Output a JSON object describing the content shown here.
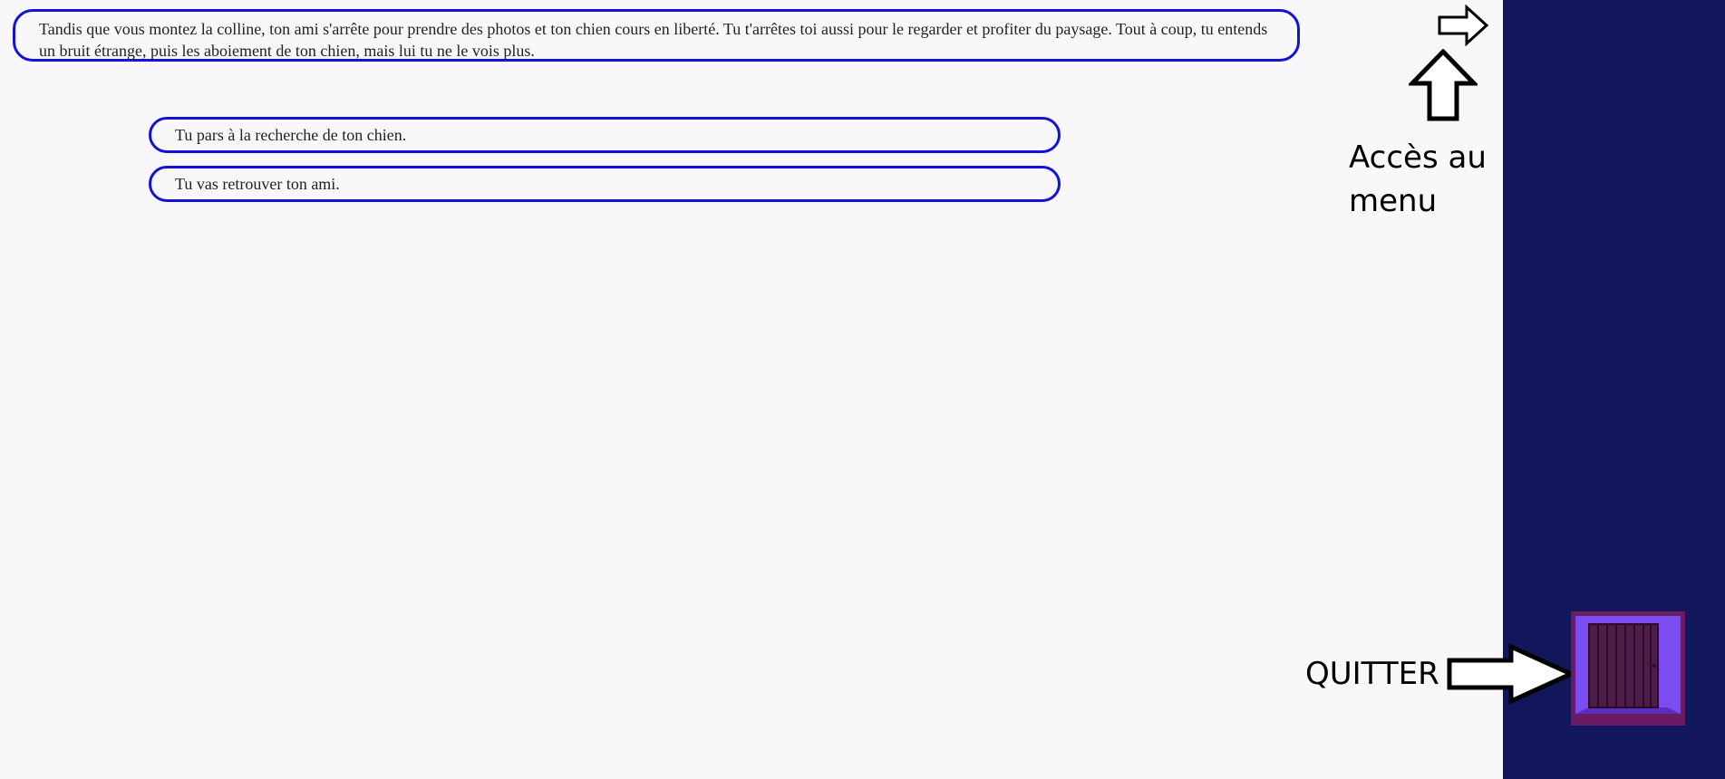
{
  "story": {
    "text": "Tandis que vous montez la colline, ton ami s'arrête pour prendre des photos et ton chien cours en liberté. Tu t'arrêtes toi aussi pour le regarder et profiter du paysage. Tout à coup, tu entends un bruit étrange, puis les aboiement de ton chien, mais lui tu ne le vois plus."
  },
  "choices": [
    {
      "label": "Tu pars à la recherche de ton chien."
    },
    {
      "label": "Tu vas retrouver ton ami."
    }
  ],
  "menu": {
    "label_line1": "Accès au",
    "label_line2": "menu",
    "icon": "arrow-right-icon"
  },
  "quit": {
    "label": "QUITTER",
    "icon": "door-icon"
  },
  "colors": {
    "background": "#f8f8fb",
    "border_accent": "#1212d8",
    "sidebar": "#12165a",
    "door_frame": "#6b1b63",
    "door_inner": "#7b4cf0",
    "door_panel": "#4e1d4a"
  }
}
